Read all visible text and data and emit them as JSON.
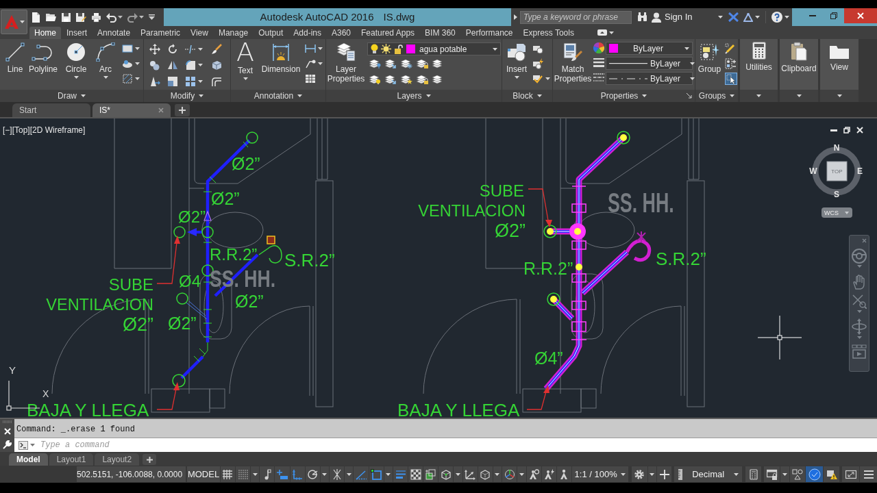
{
  "title_bar": {
    "app_title": "Autodesk AutoCAD 2016",
    "file_name": "IS.dwg",
    "search": {
      "placeholder": "Type a keyword or phrase"
    },
    "sign_in": "Sign In"
  },
  "ribbon_tabs": [
    {
      "label": "Home",
      "selected": true
    },
    {
      "label": "Insert",
      "selected": false
    },
    {
      "label": "Annotate",
      "selected": false
    },
    {
      "label": "Parametric",
      "selected": false
    },
    {
      "label": "View",
      "selected": false
    },
    {
      "label": "Manage",
      "selected": false
    },
    {
      "label": "Output",
      "selected": false
    },
    {
      "label": "Add-ins",
      "selected": false
    },
    {
      "label": "A360",
      "selected": false
    },
    {
      "label": "Featured Apps",
      "selected": false
    },
    {
      "label": "BIM 360",
      "selected": false
    },
    {
      "label": "Performance",
      "selected": false
    },
    {
      "label": "Express Tools",
      "selected": false
    }
  ],
  "ribbon": {
    "draw": {
      "title": "Draw",
      "tools": [
        "Line",
        "Polyline",
        "Circle",
        "Arc"
      ]
    },
    "modify": {
      "title": "Modify"
    },
    "annotation": {
      "title": "Annotation",
      "text_glyph": "A",
      "tools": [
        "Text",
        "Dimension"
      ]
    },
    "layers": {
      "title": "Layers",
      "tool": "Layer Properties",
      "current_layer": {
        "name": "agua potable",
        "color": "#ff00ff",
        "on": true,
        "frozen": false,
        "locked": false
      }
    },
    "block": {
      "title": "Block",
      "tool": "Insert"
    },
    "properties": {
      "title": "Properties",
      "tool": "Match Properties",
      "color": {
        "value": "ByLayer",
        "color": "#ff00ff"
      },
      "lineweight": "ByLayer",
      "linetype": "ByLayer"
    },
    "groups": {
      "title": "Groups",
      "tool": "Group",
      "selection_on": true
    },
    "utilities": "Utilities",
    "clipboard": "Clipboard",
    "view": "View"
  },
  "file_tabs": [
    {
      "label": "Start",
      "selected": false
    },
    {
      "label": "IS*",
      "selected": true
    }
  ],
  "viewport": {
    "controls": [
      "[−]",
      "[Top]",
      "[2D Wireframe]"
    ],
    "left_plan": {
      "pipe_labels": [
        "Ø2”",
        "Ø2”",
        "Ø2”",
        "Ø4",
        "Ø2”",
        "Ø2”"
      ],
      "fixture_labels": [
        "R.R.2”",
        "S.R.2”"
      ],
      "vent_note": [
        "SUBE",
        "VENTILACION",
        "Ø2”"
      ],
      "drain_note": "BAJA Y LLEGA",
      "room_label": "SS. HH."
    },
    "right_plan": {
      "pipe_labels": [
        "Ø4”"
      ],
      "fixture_labels": [
        "R.R.2”",
        "S.R.2”"
      ],
      "vent_note": [
        "SUBE",
        "VENTILACION",
        "Ø2”"
      ],
      "drain_note": "BAJA Y LLEGA",
      "room_label": "SS. HH."
    },
    "view_cube": {
      "north": "N",
      "west": "W",
      "east": "E",
      "south": "S",
      "face": "TOP",
      "ucs_menu": "WCS"
    },
    "ucs_icon": {
      "y": "Y",
      "x": "X"
    }
  },
  "command_line": {
    "history": "Command: _.erase 1 found",
    "placeholder": "Type a command"
  },
  "layout_tabs": [
    {
      "label": "Model",
      "selected": true
    },
    {
      "label": "Layout1",
      "selected": false
    },
    {
      "label": "Layout2",
      "selected": false
    }
  ],
  "status_bar": {
    "coordinates": "502.5151, -106.0088, 0.0000",
    "space": "MODEL",
    "toggles": [
      {
        "on": false
      },
      {
        "on": false
      },
      {
        "on": false
      },
      {
        "on": true
      },
      {
        "on": true
      },
      {
        "on": false
      },
      {
        "on": false
      },
      {
        "on": true
      },
      {
        "on": true
      },
      {
        "on": true
      },
      {
        "on": false
      },
      {
        "on": false
      },
      {
        "on": false
      },
      {
        "on": false
      },
      {
        "on": false
      },
      {
        "on": false
      }
    ],
    "annotation_scale": "1:1 / 100%",
    "units": "Decimal",
    "hardware_acceleration": true
  }
}
